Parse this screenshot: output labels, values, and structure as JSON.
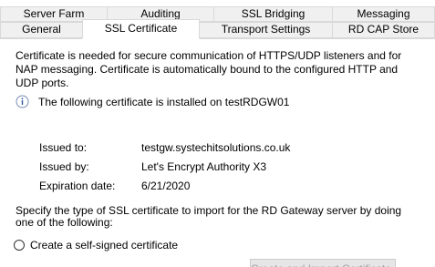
{
  "tabs": {
    "back_row": [
      {
        "label": "Server Farm"
      },
      {
        "label": "Auditing"
      },
      {
        "label": "SSL Bridging"
      },
      {
        "label": "Messaging"
      }
    ],
    "front_row": [
      {
        "label": "General"
      },
      {
        "label": "SSL Certificate",
        "active": true
      },
      {
        "label": "Transport Settings"
      },
      {
        "label": "RD CAP Store"
      }
    ]
  },
  "description": "Certificate is needed for secure communication of HTTPS/UDP listeners and for NAP messaging. Certificate is automatically bound to the configured HTTP and UDP ports.",
  "info": {
    "icon": "info-icon",
    "text": "The following certificate is installed on testRDGW01"
  },
  "certificate": {
    "issued_to_label": "Issued to:",
    "issued_to_value": "testgw.systechitsolutions.co.uk",
    "issued_by_label": "Issued by:",
    "issued_by_value": "Let's Encrypt Authority X3",
    "expiration_label": "Expiration date:",
    "expiration_value": "6/21/2020"
  },
  "instruction": "Specify the type of SSL certificate to import for the RD Gateway server by doing one of the following:",
  "options": {
    "self_signed_label": "Create a self-signed certificate",
    "self_signed_selected": false
  },
  "import_button_label": "Create and Import Certificate..."
}
